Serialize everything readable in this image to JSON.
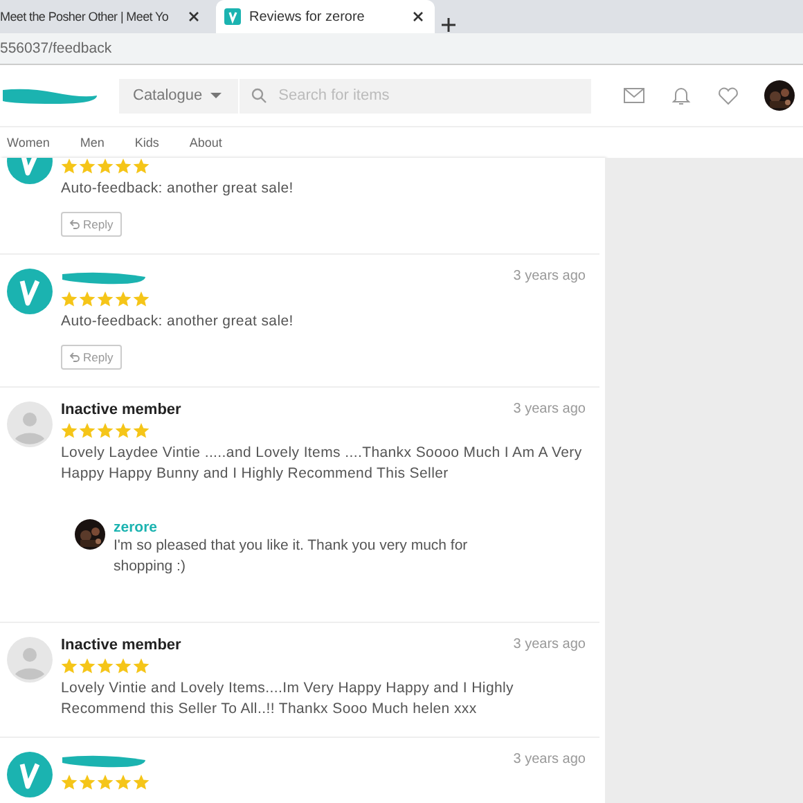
{
  "browser": {
    "tabs": [
      {
        "title": "Meet the Posher Other | Meet Yo",
        "selected": false
      },
      {
        "title": "Reviews for zerore",
        "selected": true
      }
    ],
    "address": "556037/feedback"
  },
  "header": {
    "catalogue": "Catalogue",
    "search_placeholder": "Search for items"
  },
  "nav": [
    "Women",
    "Men",
    "Kids",
    "About"
  ],
  "reviews": [
    {
      "kind": "brand",
      "cut_top": true,
      "stars": 5,
      "text": "Auto-feedback: another great sale!",
      "reply_button": "Reply"
    },
    {
      "kind": "brand",
      "name_redacted": true,
      "time": "3 years ago",
      "stars": 5,
      "text": "Auto-feedback: another great sale!",
      "reply_button": "Reply"
    },
    {
      "kind": "inactive",
      "name": "Inactive member",
      "time": "3 years ago",
      "stars": 5,
      "text": "Lovely Laydee Vintie .....and Lovely Items ....Thankx Soooo Much I Am A Very Happy Happy Bunny and I Highly Recommend This Seller",
      "reply": {
        "author": "zerore",
        "text": "I'm so pleased that you like it. Thank you very much for shopping :)"
      }
    },
    {
      "kind": "inactive",
      "name": "Inactive member",
      "time": "3 years ago",
      "stars": 5,
      "text": "Lovely Vintie and Lovely Items....Im Very Happy Happy and I Highly Recommend this Seller To All..!! Thankx Sooo Much helen xxx"
    },
    {
      "kind": "brand",
      "name_redacted": true,
      "time": "3 years ago",
      "stars": 5
    }
  ]
}
